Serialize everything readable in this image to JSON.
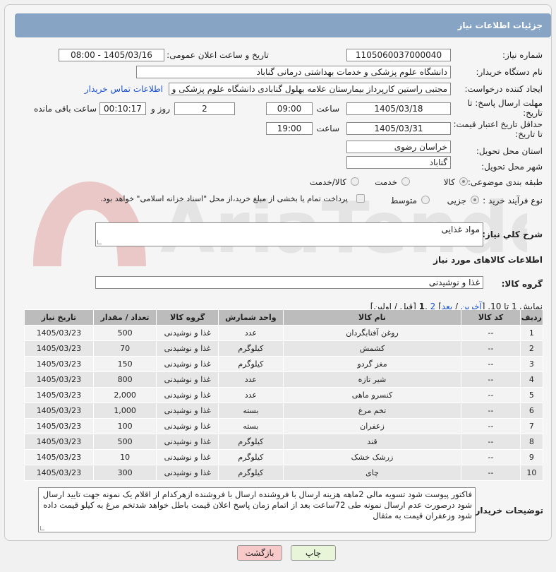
{
  "header": {
    "title": "جزئیات اطلاعات نیاز"
  },
  "fields": {
    "need_number_label": "شماره نیاز:",
    "need_number": "1105060037000040",
    "announce_label": "تاریخ و ساعت اعلان عمومی:",
    "announce_value": "1405/03/16 - 08:00",
    "buyer_org_label": "نام دستگاه خریدار:",
    "buyer_org": "دانشگاه علوم پزشکی و خدمات بهداشتی درمانی گناباد",
    "creator_label": "ایجاد کننده درخواست:",
    "creator": "مجتبی راستین کارپرداز بیمارستان علامه بهلول گنابادی دانشگاه علوم پزشکی و",
    "contact_link": "اطلاعات تماس خریدار",
    "deadline_label_1": "مهلت ارسال پاسخ: تا",
    "deadline_label_2": "تاریخ:",
    "deadline_date": "1405/03/18",
    "time_label": "ساعت",
    "deadline_time": "09:00",
    "days_value": "2",
    "days_label": "روز و",
    "remaining_time": "00:10:17",
    "remaining_label": "ساعت باقی مانده",
    "min_validity_label_1": "حداقل تاریخ اعتبار قیمت:",
    "min_validity_label_2": "تا تاریخ:",
    "validity_date": "1405/03/31",
    "validity_time": "19:00",
    "province_label": "استان محل تحویل:",
    "province": "خراسان رضوی",
    "city_label": "شهر محل تحویل:",
    "city": "گناباد",
    "category_label": "طبقه بندی موضوعی:",
    "category_options": [
      "کالا",
      "خدمت",
      "کالا/خدمت"
    ],
    "process_label": "نوع فرآیند خرید :",
    "process_options": [
      "جزیی",
      "متوسط"
    ],
    "payment_note": "پرداخت تمام یا بخشی از مبلغ خرید،از محل \"اسناد خزانه اسلامی\" خواهد بود.",
    "general_desc_label": "شرح کلي نياز:",
    "general_desc": "مواد غذایی",
    "goods_info_title": "اطلاعات کالاهای مورد نیاز",
    "goods_group_label": "گروه کالا:",
    "goods_group": "غذا و نوشیدنی"
  },
  "pagination": {
    "prefix": "نمایش 1 تا 10. [",
    "last": "آخرین",
    "sep1": " / ",
    "next": "بعد",
    "sep2": "] ",
    "page2": "2",
    "comma": " ,",
    "page1": "1",
    "suffix": " [قبل / اولین]"
  },
  "table": {
    "headers": [
      "ردیف",
      "کد کالا",
      "نام کالا",
      "واحد شمارش",
      "گروه کالا",
      "تعداد / مقدار",
      "تاریخ نیاز"
    ],
    "rows": [
      [
        "1",
        "--",
        "روغن آفتابگردان",
        "عدد",
        "غذا و نوشیدنی",
        "500",
        "1405/03/23"
      ],
      [
        "2",
        "--",
        "کشمش",
        "کیلوگرم",
        "غذا و نوشیدنی",
        "70",
        "1405/03/23"
      ],
      [
        "3",
        "--",
        "مغز گردو",
        "کیلوگرم",
        "غذا و نوشیدنی",
        "150",
        "1405/03/23"
      ],
      [
        "4",
        "--",
        "شیر تازه",
        "عدد",
        "غذا و نوشیدنی",
        "800",
        "1405/03/23"
      ],
      [
        "5",
        "--",
        "کنسرو ماهی",
        "عدد",
        "غذا و نوشیدنی",
        "2,000",
        "1405/03/23"
      ],
      [
        "6",
        "--",
        "تخم مرغ",
        "بسته",
        "غذا و نوشیدنی",
        "1,000",
        "1405/03/23"
      ],
      [
        "7",
        "--",
        "زعفران",
        "بسته",
        "غذا و نوشیدنی",
        "100",
        "1405/03/23"
      ],
      [
        "8",
        "--",
        "قند",
        "کیلوگرم",
        "غذا و نوشیدنی",
        "500",
        "1405/03/23"
      ],
      [
        "9",
        "--",
        "زرشک خشک",
        "کیلوگرم",
        "غذا و نوشیدنی",
        "10",
        "1405/03/23"
      ],
      [
        "10",
        "--",
        "چای",
        "کیلوگرم",
        "غذا و نوشیدنی",
        "300",
        "1405/03/23"
      ]
    ]
  },
  "buyer_notes_label": "توضیحات خریدار:",
  "buyer_notes": "فاکتور پیوست شود تسویه مالی 2ماهه هزینه ارسال با فروشنده ارسال با فروشنده ازهرکدام از اقلام یک نمونه جهت تایید ارسال شود درصورت عدم ارسال نمونه طی 72ساعت بعد از اتمام زمان پاسخ اعلان قیمت باطل خواهد شدتخم مرغ به کیلو قیمت داده شود وزعفران قیمت به مثقال",
  "buttons": {
    "print": "چاپ",
    "back": "بازگشت"
  },
  "colors": {
    "header_bg": "#87a4c4",
    "table_header": "#bcbcbc",
    "back_btn": "#f7c9c9",
    "print_btn": "#e8f5d8"
  }
}
